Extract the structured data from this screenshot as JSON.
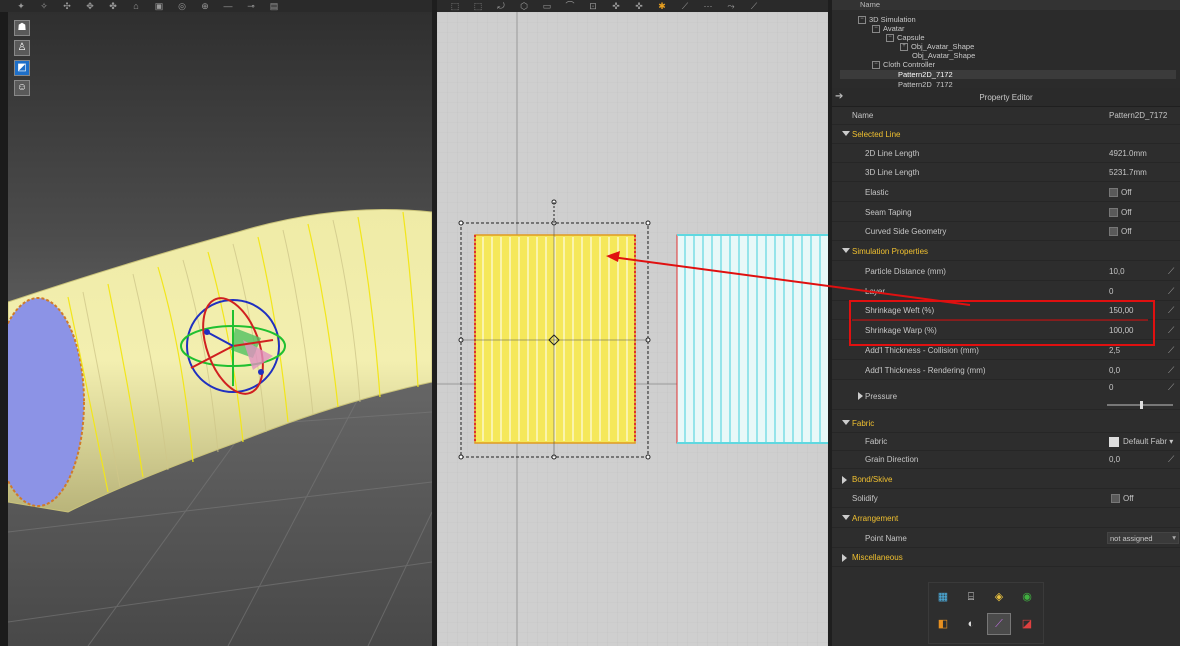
{
  "toolbar": {
    "icons": [
      "avatar-pose-icon",
      "select-mesh-icon",
      "transform-icon",
      "pin-icon",
      "brush-icon",
      "fold-icon",
      "lock-icon",
      "tape-icon",
      "draw-line-icon",
      "texture-icon",
      "select-pattern-icon",
      "edit-pattern-icon",
      "transform-pattern-icon",
      "polygon-icon",
      "rectangle-icon",
      "internal-line-icon",
      "seam-icon",
      "segment-seam-icon"
    ]
  },
  "tree": {
    "header": "Name",
    "items": [
      {
        "label": "3D Simulation",
        "toggle": "−"
      },
      {
        "label": "Avatar",
        "toggle": "−"
      },
      {
        "label": "Capsule",
        "toggle": "−"
      },
      {
        "label": "Obj_Avatar_Shape",
        "toggle": "+"
      },
      {
        "label": "Obj_Avatar_Shape",
        "toggle": ""
      },
      {
        "label": "Cloth Controller",
        "toggle": "−"
      },
      {
        "label": "Pattern2D_7172",
        "toggle": ""
      },
      {
        "label": "Pattern2D_7172",
        "toggle": ""
      }
    ]
  },
  "property_editor": {
    "title": "Property Editor",
    "name_label": "Name",
    "name_value": "Pattern2D_7172",
    "selected_line": {
      "section": "Selected Line",
      "line2d_label": "2D Line Length",
      "line2d_value": "4921.0mm",
      "line3d_label": "3D Line Length",
      "line3d_value": "5231.7mm",
      "elastic_label": "Elastic",
      "elastic_value": "Off",
      "seam_taping_label": "Seam Taping",
      "seam_taping_value": "Off",
      "curved_label": "Curved Side Geometry",
      "curved_value": "Off"
    },
    "simulation": {
      "section": "Simulation Properties",
      "particle_label": "Particle Distance (mm)",
      "particle_value": "10,0",
      "layer_label": "Layer",
      "layer_value": "0",
      "weft_label": "Shrinkage Weft (%)",
      "weft_value": "150,00",
      "warp_label": "Shrinkage Warp (%)",
      "warp_value": "100,00",
      "collision_label": "Add'l Thickness - Collision (mm)",
      "collision_value": "2,5",
      "rendering_label": "Add'l Thickness - Rendering (mm)",
      "rendering_value": "0,0",
      "pressure_label": "Pressure",
      "pressure_value": "0"
    },
    "fabric": {
      "section": "Fabric",
      "fabric_label": "Fabric",
      "fabric_value": "Default Fabr",
      "grain_label": "Grain Direction",
      "grain_value": "0,0"
    },
    "bond": {
      "section": "Bond/Skive"
    },
    "solidify": {
      "label": "Solidify",
      "value": "Off"
    },
    "arrangement": {
      "section": "Arrangement",
      "point_label": "Point Name",
      "point_value": "not assigned"
    },
    "misc": {
      "section": "Miscellaneous"
    }
  },
  "colors": {
    "section_header": "#f0c030",
    "annotation_red": "#e01010",
    "pattern_yellow": "#f5e85a",
    "pattern_cyan": "#5fd8e0"
  },
  "palette": {
    "icons": [
      "fabric-icon",
      "bottle-icon",
      "cube-icon",
      "globe-icon",
      "paint-icon",
      "sphere-icon",
      "feather-icon",
      "shield-icon"
    ]
  }
}
